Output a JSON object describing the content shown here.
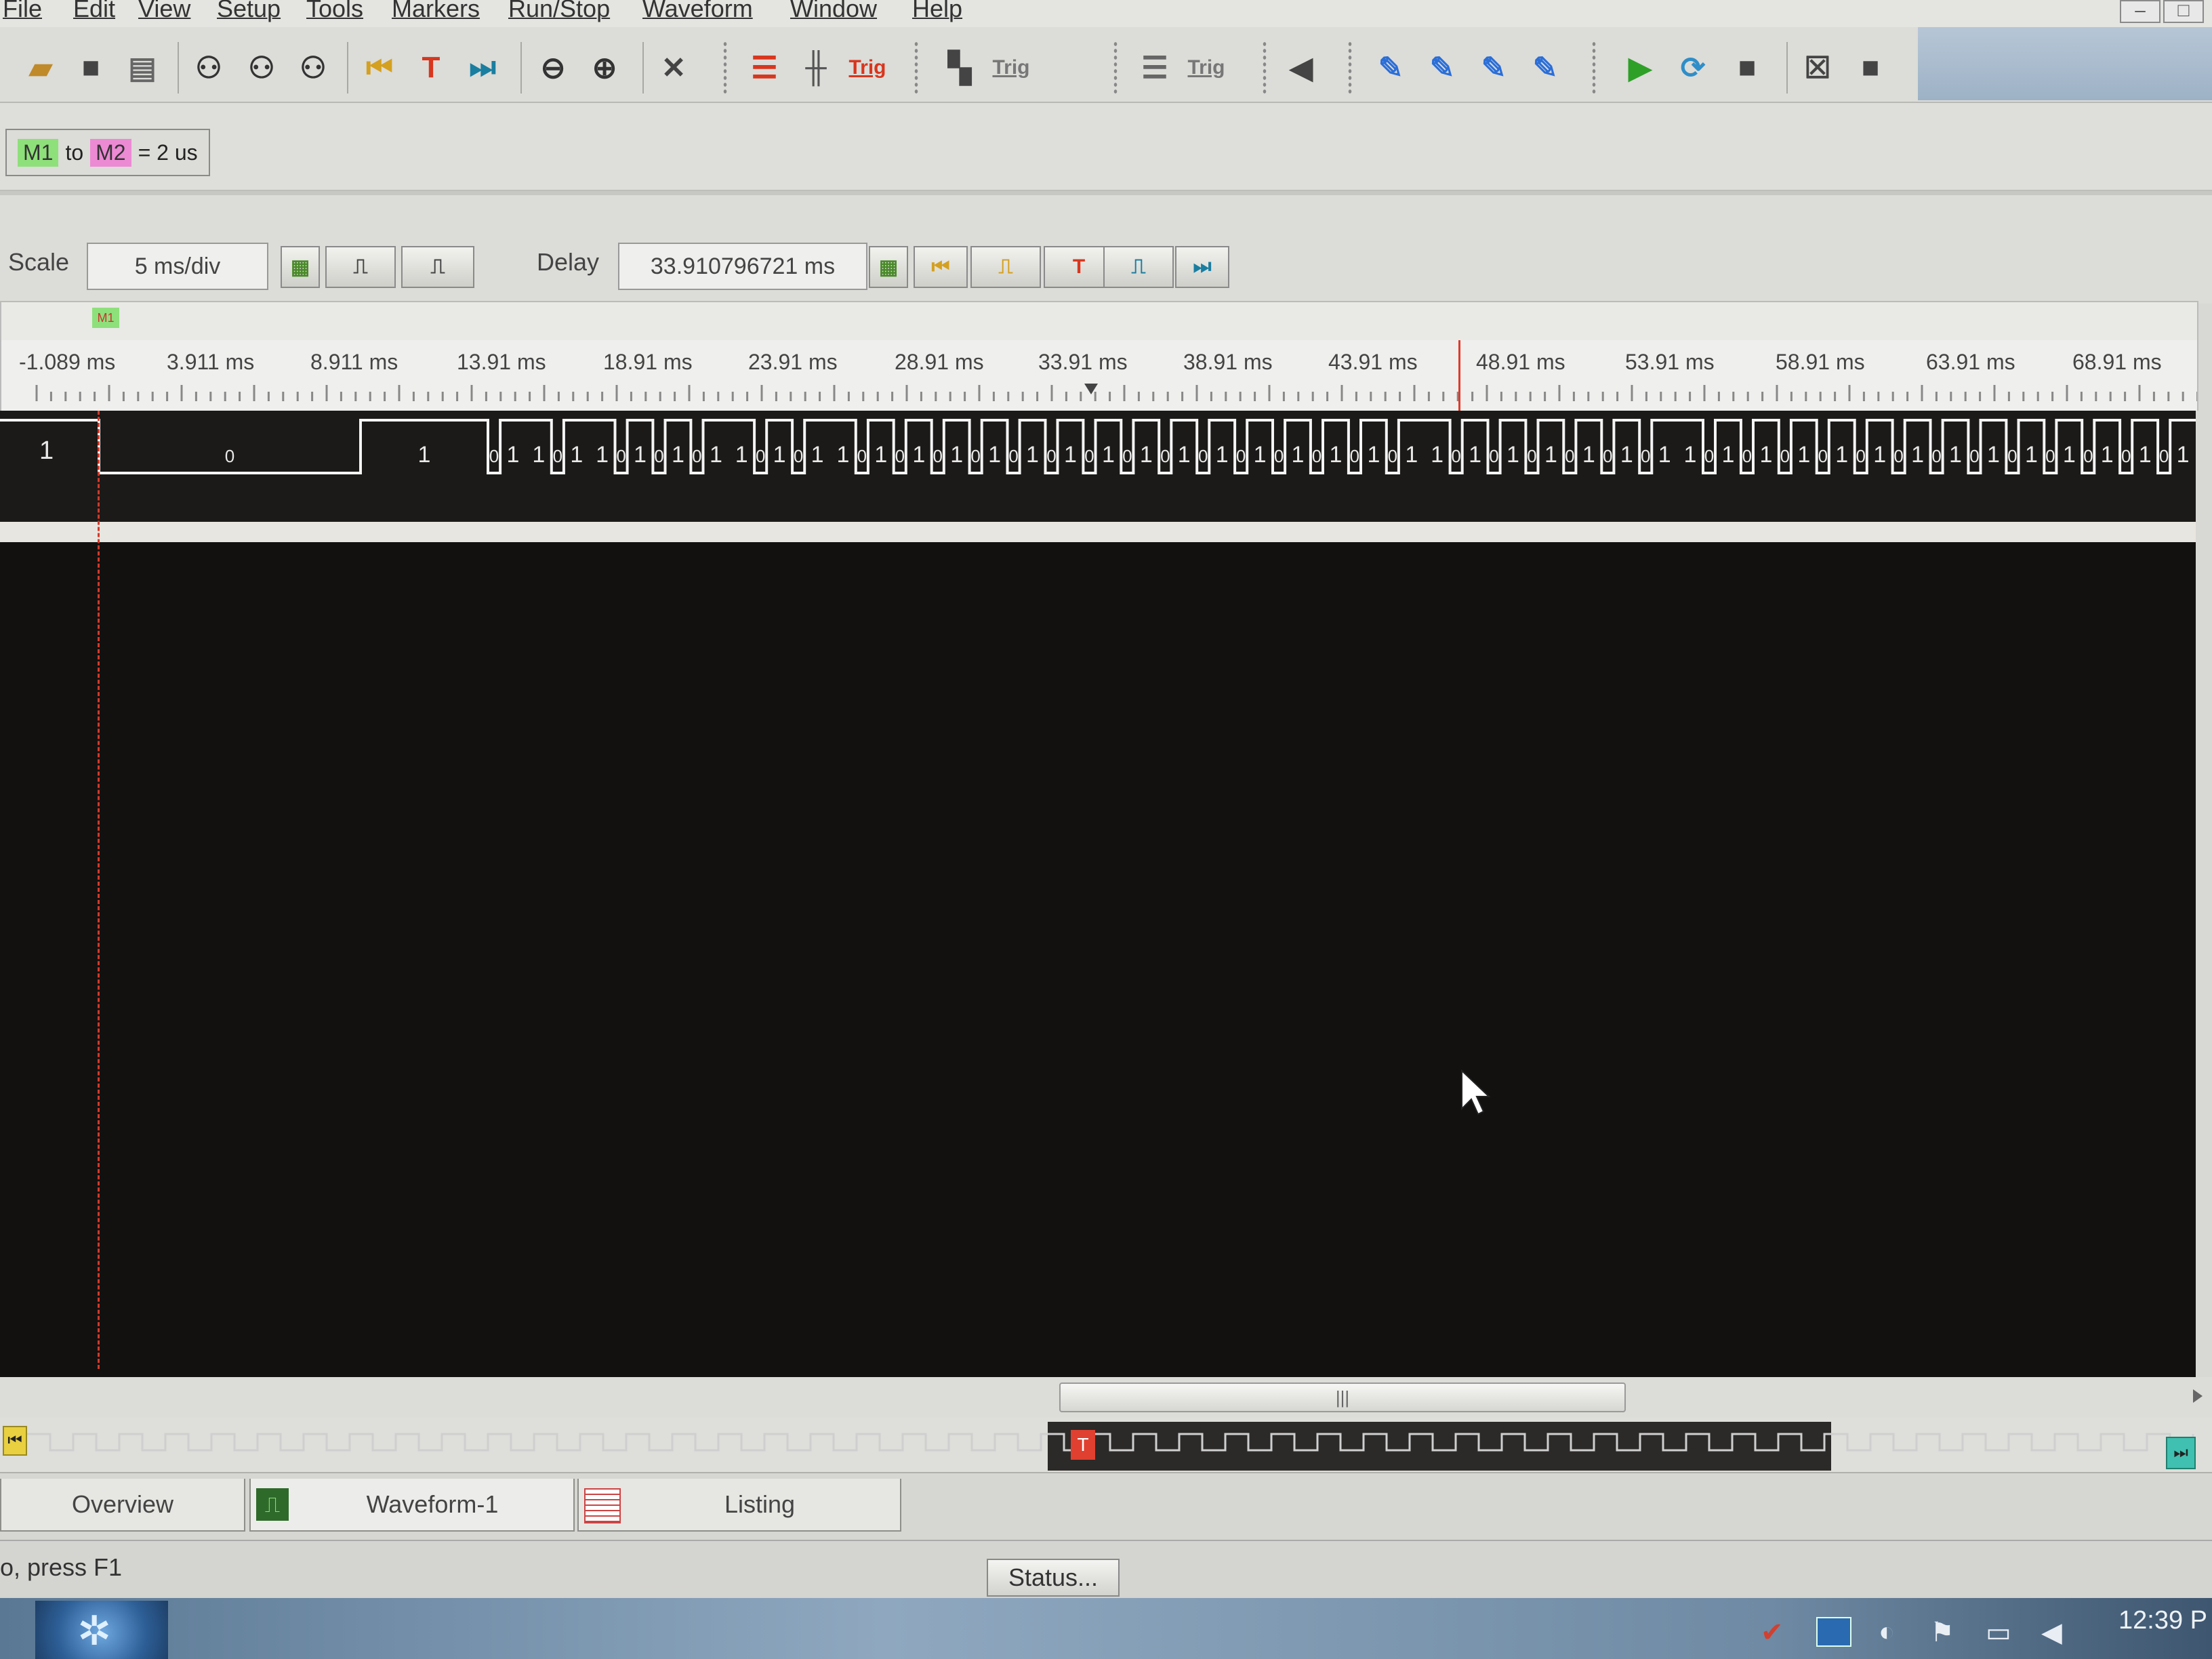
{
  "menu": [
    "File",
    "Edit",
    "View",
    "Setup",
    "Tools",
    "Markers",
    "Run/Stop",
    "Waveform",
    "Window",
    "Help"
  ],
  "window_controls": [
    "–",
    "□"
  ],
  "marker_readout": {
    "m1": "M1",
    "to": "to",
    "m2": "M2",
    "equals": "= 2 us"
  },
  "scale": {
    "label": "Scale",
    "value": "5 ms/div"
  },
  "delay": {
    "label": "Delay",
    "value": "33.910796721 ms"
  },
  "marker_flag": "M1",
  "ruler_ticks": [
    "-1.089 ms",
    "3.911 ms",
    "8.911 ms",
    "13.91 ms",
    "18.91 ms",
    "23.91 ms",
    "28.91 ms",
    "33.91 ms",
    "38.91 ms",
    "43.91 ms",
    "48.91 ms",
    "53.91 ms",
    "58.91 ms",
    "63.91 ms",
    "68.91 ms"
  ],
  "bus": {
    "label_left": "1",
    "bit_values": [
      "1",
      "0",
      "1",
      "0",
      "1",
      "1",
      "0",
      "1",
      "1",
      "0",
      "1",
      "0",
      "1",
      "0",
      "1",
      "1",
      "0",
      "1",
      "0",
      "1",
      "1",
      "0",
      "1",
      "0",
      "1",
      "0",
      "1",
      "0",
      "1",
      "0",
      "1",
      "0",
      "1",
      "0",
      "1",
      "0",
      "1",
      "0",
      "1",
      "0",
      "1",
      "0",
      "1",
      "0",
      "1",
      "0",
      "1",
      "0",
      "1",
      "0",
      "1",
      "1",
      "0",
      "1",
      "0",
      "1",
      "0",
      "1",
      "0",
      "1",
      "0",
      "1",
      "0",
      "1",
      "1",
      "0",
      "1",
      "0",
      "1",
      "0",
      "1",
      "0",
      "1",
      "0",
      "1",
      "0",
      "1",
      "0",
      "1",
      "0",
      "1",
      "0",
      "1",
      "0",
      "1",
      "0",
      "1",
      "0",
      "1",
      "0",
      "1"
    ]
  },
  "overview_trigger": "T",
  "tabs": {
    "overview": "Overview",
    "waveform": "Waveform-1",
    "listing": "Listing"
  },
  "status": {
    "hint": "o, press F1",
    "button": "Status..."
  },
  "taskbar": {
    "clock": "12:39 P"
  },
  "colors": {
    "waveform_bg": "#121110",
    "trace": "#f4f4f4",
    "cursor_line": "#e03a2a",
    "marker_m1": "#8ee07a",
    "marker_m2": "#ec8ad4"
  }
}
